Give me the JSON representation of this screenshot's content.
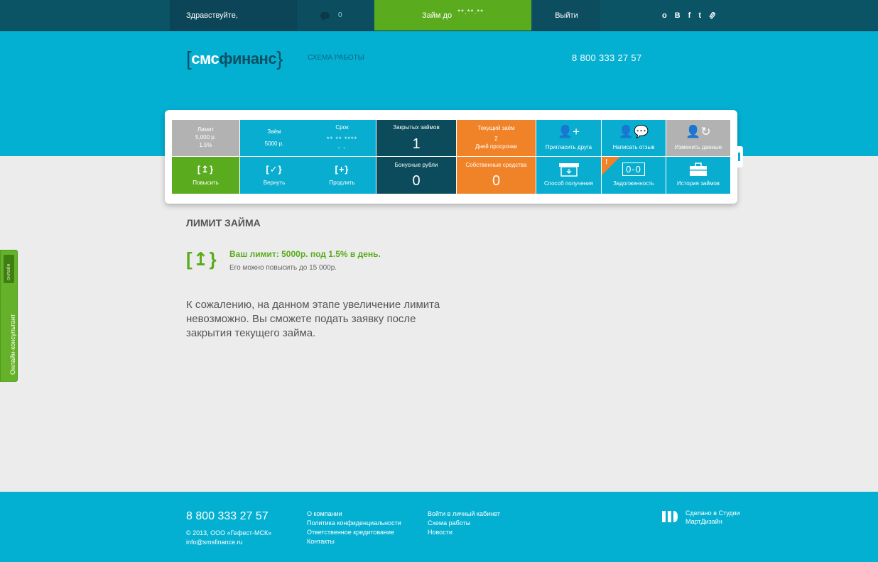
{
  "topbar": {
    "greeting": "Здравствуйте,",
    "messages_count": "0",
    "loan_label": "Займ до",
    "loan_date": "**.**.**",
    "logout": "Выйти",
    "social": [
      "о",
      "В",
      "f",
      "t"
    ]
  },
  "header": {
    "logo_open": "[",
    "logo_sms": "смс",
    "logo_fin": "финанс",
    "logo_close": "}",
    "scheme_link": "СХЕМА РАБОТЫ",
    "phone": "8 800 333 27 57"
  },
  "dashboard": {
    "limit": {
      "label": "Лимит",
      "amount": "5,000 р.",
      "rate": "1.5%"
    },
    "loan": {
      "label": "Заём",
      "amount": "5000 р."
    },
    "term": {
      "label": "Срок",
      "value": "** ** ****",
      "sub": "- -"
    },
    "closed_loans": {
      "label": "Закрытых займов",
      "value": "1"
    },
    "current_loan": {
      "label": "Текущий заём",
      "days": "2",
      "overdue": "Дней просрочки"
    },
    "invite": "Пригласить друга",
    "review": "Написать отзыв",
    "edit": "Изменить данные",
    "raise": {
      "icon": "[↥}",
      "label": "Повысить"
    },
    "return": {
      "icon": "[✓}",
      "label": "Вернуть"
    },
    "extend": {
      "icon": "[+}",
      "label": "Продлить"
    },
    "bonus": {
      "label": "Бонусные рубли",
      "value": "0"
    },
    "own_funds": {
      "label": "Собственные средства",
      "value": "0"
    },
    "receive": "Способ получения",
    "debt": {
      "label": "Задолженность",
      "display": "0-0",
      "alert": "!"
    },
    "history": "История займов"
  },
  "content": {
    "title": "ЛИМИТ ЗАЙМА",
    "icon": "[↥}",
    "limit_line": "Ваш лимит: 5000р. под  1.5% в день.",
    "limit_note": "Его можно повысить до 15 000р.",
    "message": "К сожалению, на данном этапе увеличение лимита невозможно. Вы сможете подать заявку после закрытия текущего займа."
  },
  "consultant": {
    "label": "Онлайн-консультант",
    "status": "онлайн"
  },
  "footer": {
    "phone": "8 800 333 27 57",
    "copyright": "© 2013, ООО «Гефест-МСК»",
    "email": "info@smsfinance.ru",
    "col1": [
      "О компании",
      "Политика конфиденциальности",
      "Ответственное кредитование",
      "Контакты"
    ],
    "col2": [
      "Войти в личный кабинет",
      "Схема работы",
      "Новости"
    ],
    "studio_line1": "Сделано в Студии",
    "studio_line2": "МартДизайн"
  },
  "colors": {
    "brand_blue": "#04b0d2",
    "dark_teal": "#0c4b5b",
    "green": "#5aac1e",
    "orange": "#f08228",
    "gray": "#b2b2b2"
  }
}
